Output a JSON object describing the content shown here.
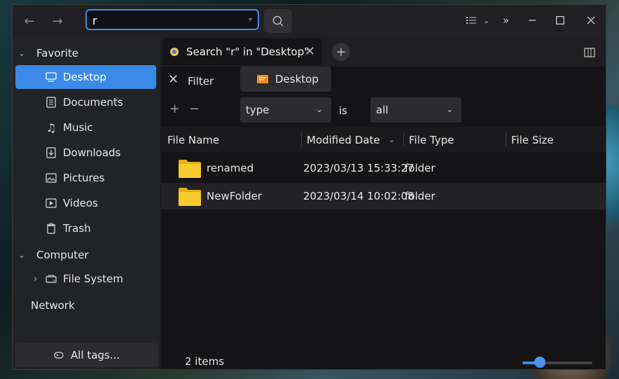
{
  "search": {
    "value": "r"
  },
  "sidebar": {
    "favorite_label": "Favorite",
    "items": [
      {
        "label": "Desktop",
        "icon": "desktop-icon",
        "active": true
      },
      {
        "label": "Documents",
        "icon": "documents-icon"
      },
      {
        "label": "Music",
        "icon": "music-icon"
      },
      {
        "label": "Downloads",
        "icon": "downloads-icon"
      },
      {
        "label": "Pictures",
        "icon": "pictures-icon"
      },
      {
        "label": "Videos",
        "icon": "videos-icon"
      },
      {
        "label": "Trash",
        "icon": "trash-icon"
      }
    ],
    "computer_label": "Computer",
    "file_system_label": "File System",
    "network_label": "Network",
    "tags_label": "All tags..."
  },
  "tab": {
    "label": "Search \"r\" in \"Desktop\""
  },
  "filter": {
    "label": "Filter",
    "location": "Desktop"
  },
  "condition": {
    "field": "type",
    "operator": "is",
    "value": "all"
  },
  "table": {
    "headers": [
      "File Name",
      "Modified Date",
      "File Type",
      "File Size"
    ],
    "rows": [
      {
        "name": "renamed",
        "modified": "2023/03/13 15:33:27",
        "type": "folder"
      },
      {
        "name": "NewFolder",
        "modified": "2023/03/14 10:02:08",
        "type": "folder"
      }
    ]
  },
  "status": {
    "count": "2 items",
    "zoom_fraction": 0.25
  },
  "colors": {
    "accent": "#3b8ae8",
    "folder": "#f5c518"
  }
}
